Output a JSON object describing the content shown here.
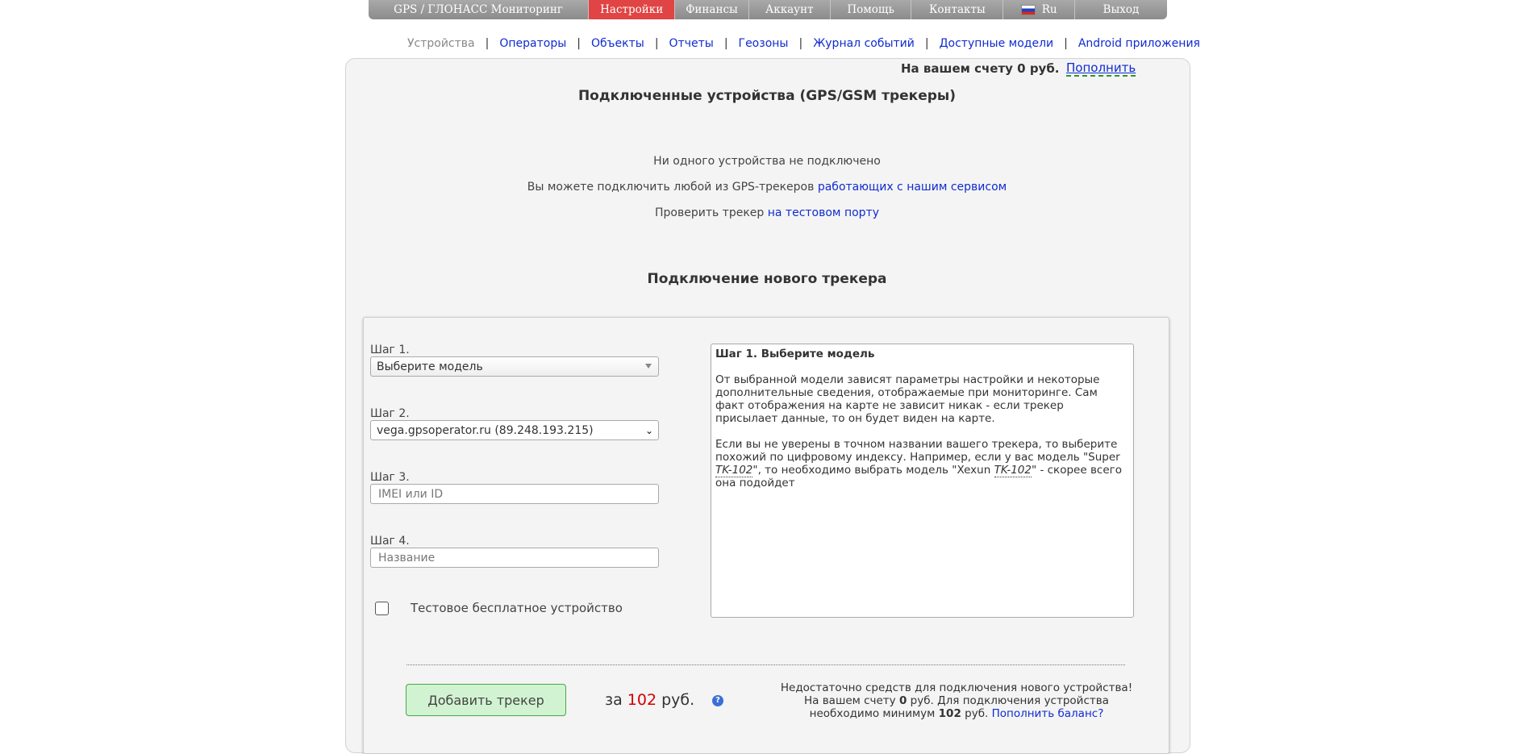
{
  "topnav": {
    "items": [
      {
        "label": "GPS / ГЛОНАСС Мониторинг"
      },
      {
        "label": "Настройки"
      },
      {
        "label": "Финансы"
      },
      {
        "label": "Аккаунт"
      },
      {
        "label": "Помощь"
      },
      {
        "label": "Контакты"
      },
      {
        "label": "Ru"
      },
      {
        "label": "Выход"
      }
    ],
    "active": "Настройки",
    "active_color": "#e04444"
  },
  "subnav": {
    "current": "Устройства",
    "links": [
      "Операторы",
      "Объекты",
      "Отчеты",
      "Геозоны",
      "Журнал событий",
      "Доступные модели",
      "Android приложения"
    ],
    "separator": "|"
  },
  "account": {
    "balance_text": "На вашем счету 0 руб.",
    "topup_label": "Пополнить"
  },
  "devices": {
    "title": "Подключенные устройства (GPS/GSM трекеры)",
    "empty_text": "Ни одного устройства не подключено",
    "connect_text": "Вы можете подключить любой из GPS-трекеров",
    "connect_link": "работающих с нашим сервисом",
    "test_text": "Проверить трекер",
    "test_link": "на тестовом порту"
  },
  "new_tracker": {
    "title": "Подключение нового трекера",
    "step1": {
      "label": "Шаг 1.",
      "value": "Выберите модель"
    },
    "step2": {
      "label": "Шаг 2.",
      "value": "vega.gpsoperator.ru (89.248.193.215)"
    },
    "step3": {
      "label": "Шаг 3.",
      "placeholder": "IMEI или ID"
    },
    "step4": {
      "label": "Шаг 4.",
      "placeholder": "Название"
    },
    "test_device_label": "Тестовое бесплатное устройство",
    "help": {
      "title": "Шаг 1. Выберите модель",
      "p1": "От выбранной модели зависят параметры настройки и некоторые дополнительные сведения, отображаемые при мониторинге. Сам факт отображения на карте не зависит никак - если трекер присылает данные, то он будет виден на карте.",
      "p2_a": "Если вы не уверены в точном названии вашего трекера, то выберите похожий по цифровому индексу. Например, если у вас модель \"Super ",
      "p2_abbr1": "TK-102",
      "p2_b": "\", то необходимо выбрать модель \"Xexun ",
      "p2_abbr2": "TK-102",
      "p2_c": "\" - скорее всего она подойдет"
    },
    "add_button": "Добавить трекер",
    "price_prefix": "за",
    "price_value": "102",
    "price_suffix": "руб.",
    "warning": {
      "line1": "Недостаточно средств для подключения нового устройства!",
      "line2_a": "На вашем счету ",
      "line2_b": "0",
      "line2_c": " руб. Для подключения устройства необходимо минимум ",
      "line2_d": "102",
      "line2_e": " руб. ",
      "link": "Пополнить баланс?"
    }
  }
}
